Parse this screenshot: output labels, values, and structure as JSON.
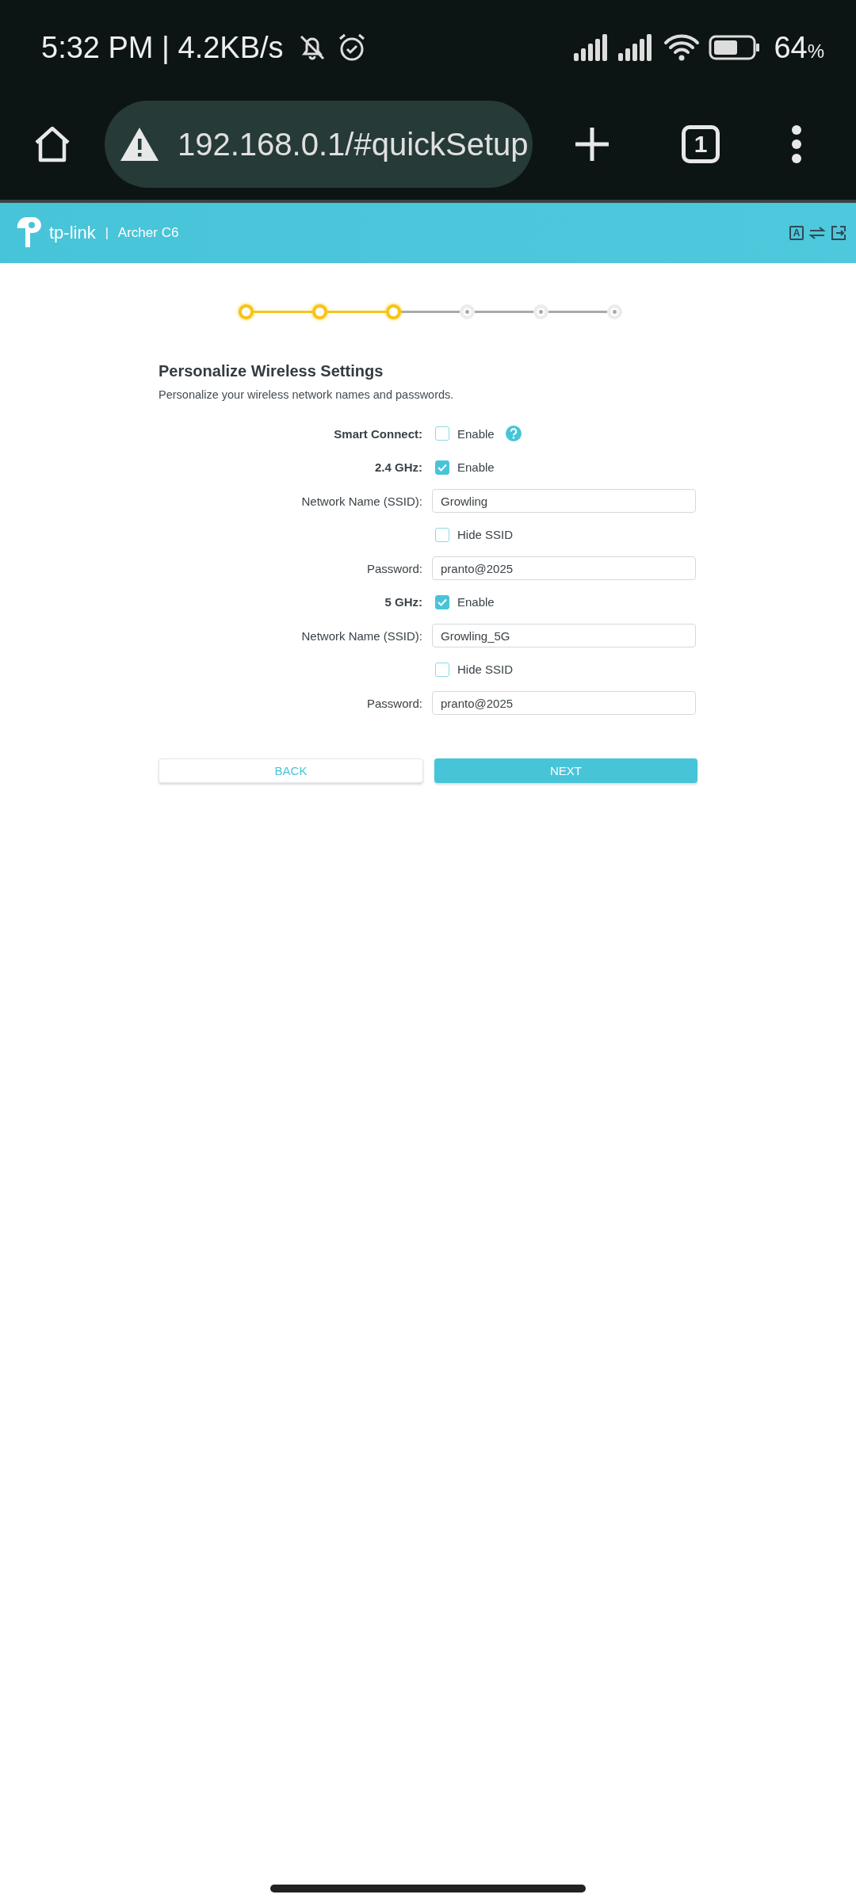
{
  "status_bar": {
    "time_speed": "5:32 PM | 4.2KB/s",
    "battery": "64",
    "battery_unit": "%"
  },
  "browser": {
    "url": "192.168.0.1/#quickSetup",
    "tab_count": "1"
  },
  "header": {
    "brand": "tp-link",
    "separator": "|",
    "model": "Archer C6",
    "language_key": "A"
  },
  "stepper": [
    {
      "completed": true
    },
    {
      "completed": true
    },
    {
      "completed": true
    },
    {
      "completed": false
    },
    {
      "completed": false
    },
    {
      "completed": false
    }
  ],
  "section": {
    "title": "Personalize Wireless Settings",
    "subtitle": "Personalize your wireless network names and passwords."
  },
  "form": [
    {
      "kind": "band",
      "label": "Smart Connect:",
      "option": "Enable",
      "checked": false,
      "help": true
    },
    {
      "kind": "band",
      "label": "2.4 GHz:",
      "option": "Enable",
      "checked": true
    },
    {
      "kind": "input",
      "label": "Network Name (SSID):",
      "value": "Growling"
    },
    {
      "kind": "checkbox",
      "option": "Hide SSID",
      "checked": false
    },
    {
      "kind": "input",
      "label": "Password:",
      "value": "pranto@2025"
    },
    {
      "kind": "band",
      "label": "5 GHz:",
      "option": "Enable",
      "checked": true
    },
    {
      "kind": "input",
      "label": "Network Name (SSID):",
      "value": "Growling_5G"
    },
    {
      "kind": "checkbox",
      "option": "Hide SSID",
      "checked": false
    },
    {
      "kind": "input",
      "label": "Password:",
      "value": "pranto@2025"
    }
  ],
  "buttons": {
    "back": "BACK",
    "next": "NEXT"
  }
}
